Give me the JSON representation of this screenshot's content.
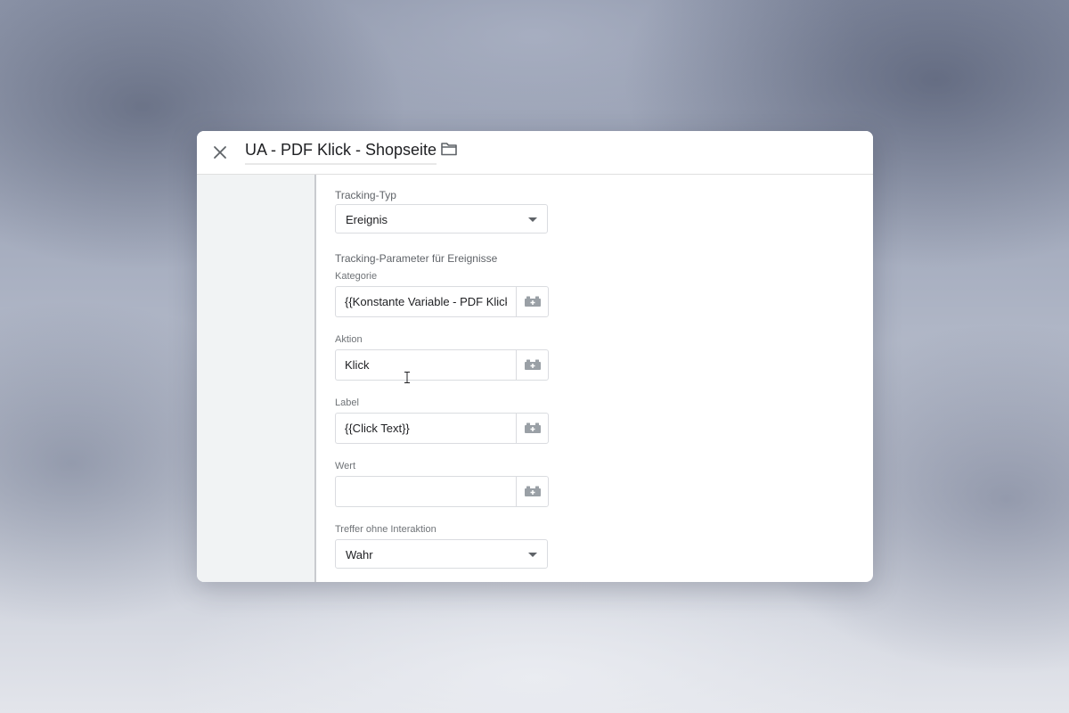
{
  "header": {
    "title": "UA - PDF Klick - Shopseite"
  },
  "icons": {
    "close": "close-icon",
    "folder": "folder-icon",
    "variable": "variable-block-icon",
    "dropdown": "chevron-down-icon",
    "cursor": "text-cursor-icon"
  },
  "form": {
    "tracking_type": {
      "label": "Tracking-Typ",
      "value": "Ereignis"
    },
    "event_params_heading": "Tracking-Parameter für Ereignisse",
    "category": {
      "label": "Kategorie",
      "value": "{{Konstante Variable - PDF Klick}}"
    },
    "action": {
      "label": "Aktion",
      "value": "Klick"
    },
    "event_label": {
      "label": "Label",
      "value": "{{Click Text}}"
    },
    "value_field": {
      "label": "Wert",
      "value": ""
    },
    "non_interaction": {
      "label": "Treffer ohne Interaktion",
      "value": "Wahr"
    }
  },
  "colors": {
    "text_primary": "#202124",
    "text_secondary": "#5f6368",
    "border": "#dadce0",
    "icon_gray": "#9aa0a6",
    "left_pane": "#f1f3f4"
  }
}
